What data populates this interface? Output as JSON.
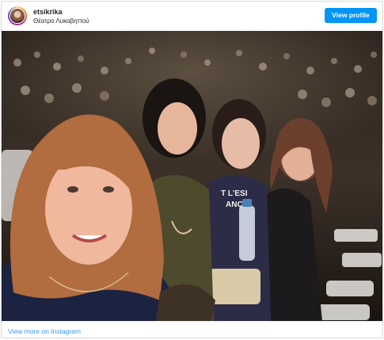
{
  "post": {
    "username": "etsikrika",
    "location": "Θέατρο Λυκαβηττού",
    "view_profile_label": "View profile",
    "footer_link": "View more on Instagram",
    "photo_alt": "Four women taking a selfie at an outdoor theatre concert",
    "shirt_text_line1": "T L'ESI",
    "shirt_text_line2": "ANÇA"
  },
  "colors": {
    "button": "#0095f6",
    "link": "#3897f0"
  },
  "icons": {
    "avatar": "profile-avatar-icon"
  }
}
